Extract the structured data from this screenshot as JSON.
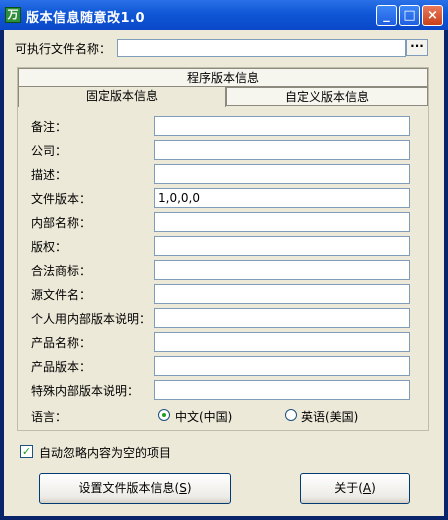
{
  "window": {
    "title": "版本信息随意改1.0"
  },
  "titlebar_buttons": {
    "minimize": "_",
    "maximize": "□",
    "close": "×"
  },
  "exe": {
    "label": "可执行文件名称：",
    "value": "",
    "browse": "···"
  },
  "tabs": {
    "top": "程序版本信息",
    "fixed": "固定版本信息",
    "custom": "自定义版本信息"
  },
  "fields": [
    {
      "label": "备注：",
      "value": ""
    },
    {
      "label": "公司：",
      "value": ""
    },
    {
      "label": "描述：",
      "value": ""
    },
    {
      "label": "文件版本：",
      "value": "1,0,0,0"
    },
    {
      "label": "内部名称：",
      "value": ""
    },
    {
      "label": "版权：",
      "value": ""
    },
    {
      "label": "合法商标：",
      "value": ""
    },
    {
      "label": "源文件名：",
      "value": ""
    },
    {
      "label": "个人用内部版本说明：",
      "value": ""
    },
    {
      "label": "产品名称：",
      "value": ""
    },
    {
      "label": "产品版本：",
      "value": ""
    },
    {
      "label": "特殊内部版本说明：",
      "value": ""
    }
  ],
  "language": {
    "label": "语言：",
    "options": [
      {
        "label": "中文(中国)",
        "selected": true
      },
      {
        "label": "英语(美国)",
        "selected": false
      }
    ]
  },
  "auto_ignore": {
    "label": "自动忽略内容为空的项目",
    "checked": true
  },
  "buttons": {
    "set_prefix": "设置文件版本信息(",
    "set_key": "S",
    "set_suffix": ")",
    "about_prefix": "关于(",
    "about_key": "A",
    "about_suffix": ")"
  }
}
